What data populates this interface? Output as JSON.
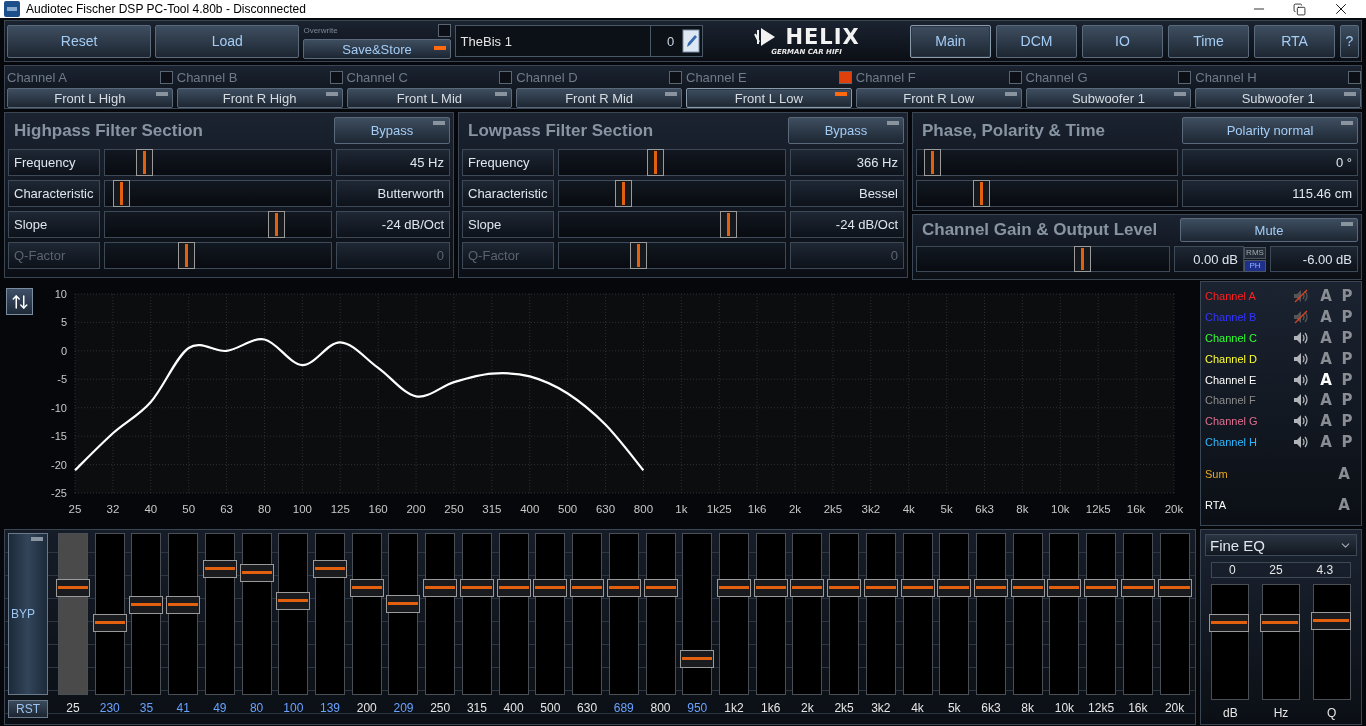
{
  "window": {
    "title": "Audiotec Fischer DSP PC-Tool 4.80b - Disconnected"
  },
  "toolbar": {
    "buttons": [
      "Reset",
      "Load"
    ],
    "save": {
      "label": "Overwrite",
      "overwrite_checked": false,
      "button": "Save&Store",
      "led_on": true
    },
    "preset": {
      "name": "TheBis 1",
      "number": "0"
    },
    "logo": {
      "name": "HELIX",
      "tagline": "GERMAN CAR HIFI"
    },
    "nav": [
      {
        "label": "Main",
        "selected": true
      },
      {
        "label": "DCM",
        "selected": false
      },
      {
        "label": "IO",
        "selected": false
      },
      {
        "label": "Time",
        "selected": false
      },
      {
        "label": "RTA",
        "selected": false
      },
      {
        "label": "?",
        "selected": false
      }
    ]
  },
  "channels": [
    {
      "label": "Channel A",
      "linked": false,
      "output": "Front L High",
      "selected": false
    },
    {
      "label": "Channel B",
      "linked": false,
      "output": "Front R High",
      "selected": false
    },
    {
      "label": "Channel C",
      "linked": false,
      "output": "Front L Mid",
      "selected": false
    },
    {
      "label": "Channel D",
      "linked": false,
      "output": "Front R Mid",
      "selected": false
    },
    {
      "label": "Channel E",
      "linked": true,
      "output": "Front L Low",
      "selected": true
    },
    {
      "label": "Channel F",
      "linked": false,
      "output": "Front R Low",
      "selected": false
    },
    {
      "label": "Channel G",
      "linked": false,
      "output": "Subwoofer 1",
      "selected": false
    },
    {
      "label": "Channel H",
      "linked": false,
      "output": "Subwoofer 1",
      "selected": false
    }
  ],
  "highpass": {
    "title": "Highpass Filter Section",
    "button": {
      "label": "Bypass",
      "led_on": false
    },
    "rows": [
      {
        "label": "Frequency",
        "level": 0.15,
        "value": "45 Hz",
        "disabled": false
      },
      {
        "label": "Characteristic",
        "level": 0.04,
        "value": "Butterworth",
        "disabled": false
      },
      {
        "label": "Slope",
        "level": 0.78,
        "value": "-24 dB/Oct",
        "disabled": false
      },
      {
        "label": "Q-Factor",
        "level": 0.35,
        "value": "0",
        "disabled": true
      }
    ]
  },
  "lowpass": {
    "title": "Lowpass Filter Section",
    "button": {
      "label": "Bypass",
      "led_on": false
    },
    "rows": [
      {
        "label": "Frequency",
        "level": 0.42,
        "value": "366 Hz",
        "disabled": false
      },
      {
        "label": "Characteristic",
        "level": 0.27,
        "value": "Bessel",
        "disabled": false
      },
      {
        "label": "Slope",
        "level": 0.77,
        "value": "-24 dB/Oct",
        "disabled": false
      },
      {
        "label": "Q-Factor",
        "level": 0.34,
        "value": "0",
        "disabled": true
      }
    ]
  },
  "phase": {
    "title": "Phase, Polarity & Time",
    "button": {
      "label": "Polarity normal",
      "led_on": false
    },
    "rows": [
      {
        "level": 0.03,
        "value": "0 °"
      },
      {
        "level": 0.23,
        "value": "115.46 cm"
      }
    ]
  },
  "gain": {
    "title": "Channel Gain & Output Level",
    "button": {
      "label": "Mute",
      "led_on": false
    },
    "level": 0.67,
    "gain_value": "0.00 dB",
    "meter_modes": [
      {
        "label": "RMS",
        "selected": false
      },
      {
        "label": "PH",
        "selected": true
      }
    ],
    "output_value": "-6.00 dB"
  },
  "response": {
    "chart_data": {
      "type": "line",
      "categories": [
        "25",
        "32",
        "40",
        "50",
        "63",
        "80",
        "100",
        "125",
        "160",
        "200",
        "250",
        "315",
        "400",
        "500",
        "630",
        "800",
        "1k",
        "1k25",
        "1k6",
        "2k",
        "2k5",
        "3k2",
        "4k",
        "5k",
        "6k3",
        "8k",
        "10k",
        "12k5",
        "16k",
        "20k"
      ],
      "grid": true,
      "series": [
        {
          "color": "#ffffff",
          "values": [
            -21,
            -14.5,
            -9,
            0.5,
            0,
            2,
            -2.5,
            1.5,
            -3,
            -8,
            -5.5,
            -4,
            -4.5,
            -7.5,
            -13,
            -21,
            null,
            null,
            null,
            null,
            null,
            null,
            null,
            null,
            null,
            null,
            null,
            null,
            null,
            null
          ]
        }
      ],
      "ylim": [
        -25,
        10
      ],
      "yticks": [
        -25,
        -20,
        -15,
        -10,
        -5,
        0,
        5,
        10
      ]
    }
  },
  "legend": [
    {
      "kind": "channel",
      "label": "Channel A",
      "color": "#ff2020",
      "muted": true,
      "a_label": "A",
      "a_selected": false,
      "p_label": "P"
    },
    {
      "kind": "channel",
      "label": "Channel B",
      "color": "#3434ff",
      "muted": true,
      "a_label": "A",
      "a_selected": false,
      "p_label": "P"
    },
    {
      "kind": "channel",
      "label": "Channel C",
      "color": "#30ff30",
      "muted": false,
      "a_label": "A",
      "a_selected": false,
      "p_label": "P"
    },
    {
      "kind": "channel",
      "label": "Channel D",
      "color": "#ffff30",
      "muted": false,
      "a_label": "A",
      "a_selected": false,
      "p_label": "P"
    },
    {
      "kind": "channel",
      "label": "Channel E",
      "color": "#ffffff",
      "muted": false,
      "a_label": "A",
      "a_selected": true,
      "p_label": "P"
    },
    {
      "kind": "channel",
      "label": "Channel F",
      "color": "#8c8c8c",
      "muted": false,
      "a_label": "A",
      "a_selected": false,
      "p_label": "P"
    },
    {
      "kind": "channel",
      "label": "Channel G",
      "color": "#e07090",
      "muted": false,
      "a_label": "A",
      "a_selected": false,
      "p_label": "P"
    },
    {
      "kind": "channel",
      "label": "Channel H",
      "color": "#30b8ff",
      "muted": false,
      "a_label": "A",
      "a_selected": false,
      "p_label": "P"
    },
    {
      "kind": "bus",
      "label": "Sum",
      "color": "#e8a820",
      "a_label": "A",
      "a_selected": false
    },
    {
      "kind": "bus",
      "label": "RTA",
      "color": "#ffffff",
      "a_label": "A",
      "a_selected": false
    }
  ],
  "eq": {
    "bypass": {
      "label": "BYP",
      "led_on": false
    },
    "reset": "RST",
    "bands": [
      {
        "label": "25",
        "level": 0.68,
        "modified": false,
        "selected": true
      },
      {
        "label": "230",
        "level": 0.44,
        "modified": true,
        "selected": false
      },
      {
        "label": "35",
        "level": 0.56,
        "modified": true,
        "selected": false
      },
      {
        "label": "41",
        "level": 0.56,
        "modified": true,
        "selected": false
      },
      {
        "label": "49",
        "level": 0.82,
        "modified": true,
        "selected": false
      },
      {
        "label": "80",
        "level": 0.79,
        "modified": true,
        "selected": false
      },
      {
        "label": "100",
        "level": 0.59,
        "modified": true,
        "selected": false
      },
      {
        "label": "139",
        "level": 0.82,
        "modified": true,
        "selected": false
      },
      {
        "label": "200",
        "level": 0.68,
        "modified": false,
        "selected": false
      },
      {
        "label": "209",
        "level": 0.57,
        "modified": true,
        "selected": false
      },
      {
        "label": "250",
        "level": 0.68,
        "modified": false,
        "selected": false
      },
      {
        "label": "315",
        "level": 0.68,
        "modified": false,
        "selected": false
      },
      {
        "label": "400",
        "level": 0.68,
        "modified": false,
        "selected": false
      },
      {
        "label": "500",
        "level": 0.68,
        "modified": false,
        "selected": false
      },
      {
        "label": "630",
        "level": 0.68,
        "modified": false,
        "selected": false
      },
      {
        "label": "689",
        "level": 0.68,
        "modified": true,
        "selected": false
      },
      {
        "label": "800",
        "level": 0.68,
        "modified": false,
        "selected": false
      },
      {
        "label": "950",
        "level": 0.18,
        "modified": true,
        "selected": false
      },
      {
        "label": "1k2",
        "level": 0.68,
        "modified": false,
        "selected": false
      },
      {
        "label": "1k6",
        "level": 0.68,
        "modified": false,
        "selected": false
      },
      {
        "label": "2k",
        "level": 0.68,
        "modified": false,
        "selected": false
      },
      {
        "label": "2k5",
        "level": 0.68,
        "modified": false,
        "selected": false
      },
      {
        "label": "3k2",
        "level": 0.68,
        "modified": false,
        "selected": false
      },
      {
        "label": "4k",
        "level": 0.68,
        "modified": false,
        "selected": false
      },
      {
        "label": "5k",
        "level": 0.68,
        "modified": false,
        "selected": false
      },
      {
        "label": "6k3",
        "level": 0.68,
        "modified": false,
        "selected": false
      },
      {
        "label": "8k",
        "level": 0.68,
        "modified": false,
        "selected": false
      },
      {
        "label": "10k",
        "level": 0.68,
        "modified": false,
        "selected": false
      },
      {
        "label": "12k5",
        "level": 0.68,
        "modified": false,
        "selected": false
      },
      {
        "label": "16k",
        "level": 0.68,
        "modified": false,
        "selected": false
      },
      {
        "label": "20k",
        "level": 0.68,
        "modified": false,
        "selected": false
      }
    ]
  },
  "fine_eq": {
    "mode": "Fine EQ",
    "values": [
      "0",
      "25",
      "4.3"
    ],
    "sliders": [
      {
        "label": "dB",
        "level": 0.7
      },
      {
        "label": "Hz",
        "level": 0.7
      },
      {
        "label": "Q",
        "level": 0.72
      }
    ]
  }
}
